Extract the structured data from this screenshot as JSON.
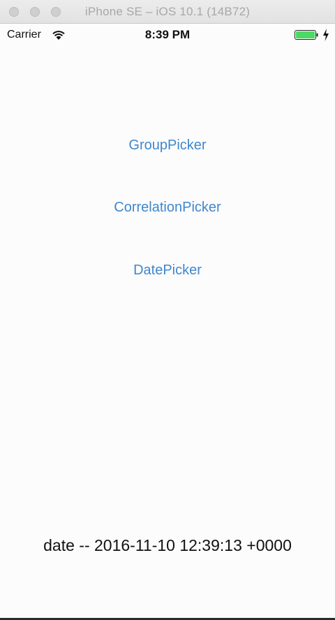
{
  "window": {
    "title": "iPhone SE – iOS 10.1 (14B72)"
  },
  "status_bar": {
    "carrier": "Carrier",
    "time": "8:39 PM",
    "battery_color": "#4cd964"
  },
  "buttons": {
    "group_picker": "GroupPicker",
    "correlation_picker": "CorrelationPicker",
    "date_picker": "DatePicker"
  },
  "date_label": "date -- 2016-11-10 12:39:13 +0000",
  "colors": {
    "tint": "#3f87cb",
    "text": "#111111"
  },
  "icons": {
    "wifi": "wifi-icon",
    "battery": "battery-icon",
    "charging": "charging-bolt-icon"
  }
}
